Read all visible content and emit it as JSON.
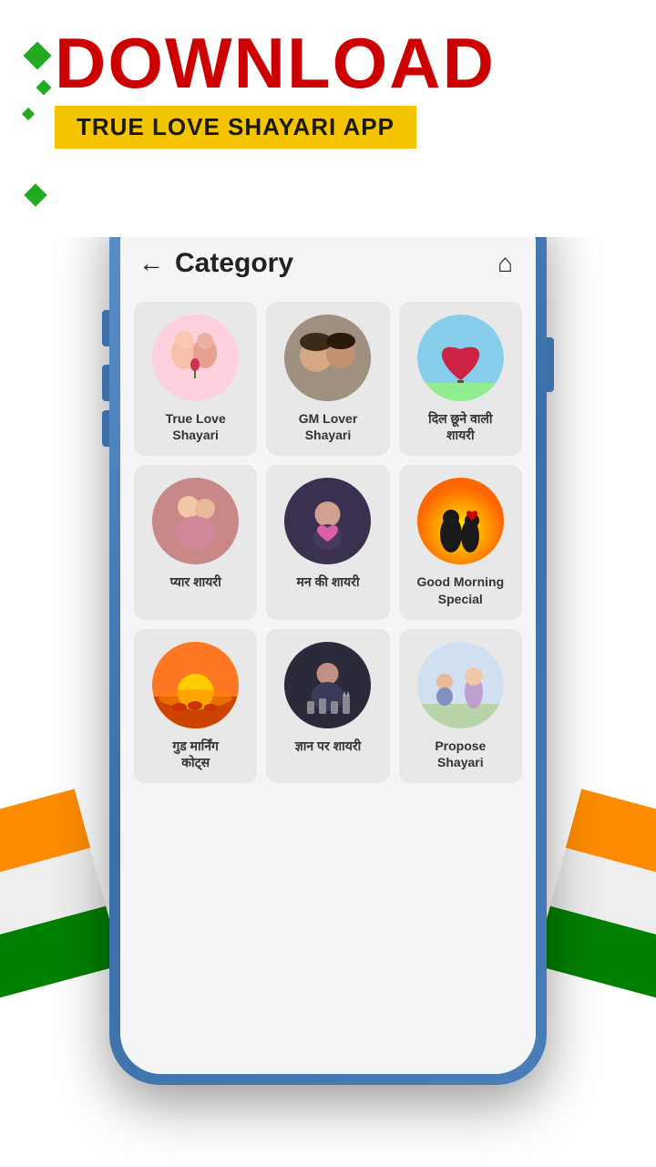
{
  "banner": {
    "download_label": "DOWNLOAD",
    "subtitle": "TRUE LOVE SHAYARI APP"
  },
  "app": {
    "header": {
      "title": "Category",
      "back_label": "←",
      "home_label": "⌂"
    },
    "categories": [
      {
        "id": "true-love",
        "label": "True Love\nShayari",
        "emoji": "💑",
        "bg": "true-love"
      },
      {
        "id": "gm-lover",
        "label": "GM Lover\nShayari",
        "emoji": "💏",
        "bg": "gm-lover"
      },
      {
        "id": "dil-chune",
        "label": "दिल छूने वाली\nशायरी",
        "emoji": "🌹",
        "bg": "dil"
      },
      {
        "id": "pyaar",
        "label": "प्यार शायरी",
        "emoji": "🤗",
        "bg": "pyaar"
      },
      {
        "id": "man-ki",
        "label": "मन की शायरी",
        "emoji": "💔",
        "bg": "man"
      },
      {
        "id": "gm-special",
        "label": "Good Morning Special",
        "emoji": "🌅",
        "bg": "gm-special"
      },
      {
        "id": "gud-morning",
        "label": "गुड मार्निंग\nकोट्स",
        "emoji": "🌄",
        "bg": "gud-morning"
      },
      {
        "id": "gyan",
        "label": "ज्ञान पर शायरी",
        "emoji": "♟",
        "bg": "gyan"
      },
      {
        "id": "propose",
        "label": "Propose\nShayari",
        "emoji": "💍",
        "bg": "propose"
      }
    ]
  }
}
